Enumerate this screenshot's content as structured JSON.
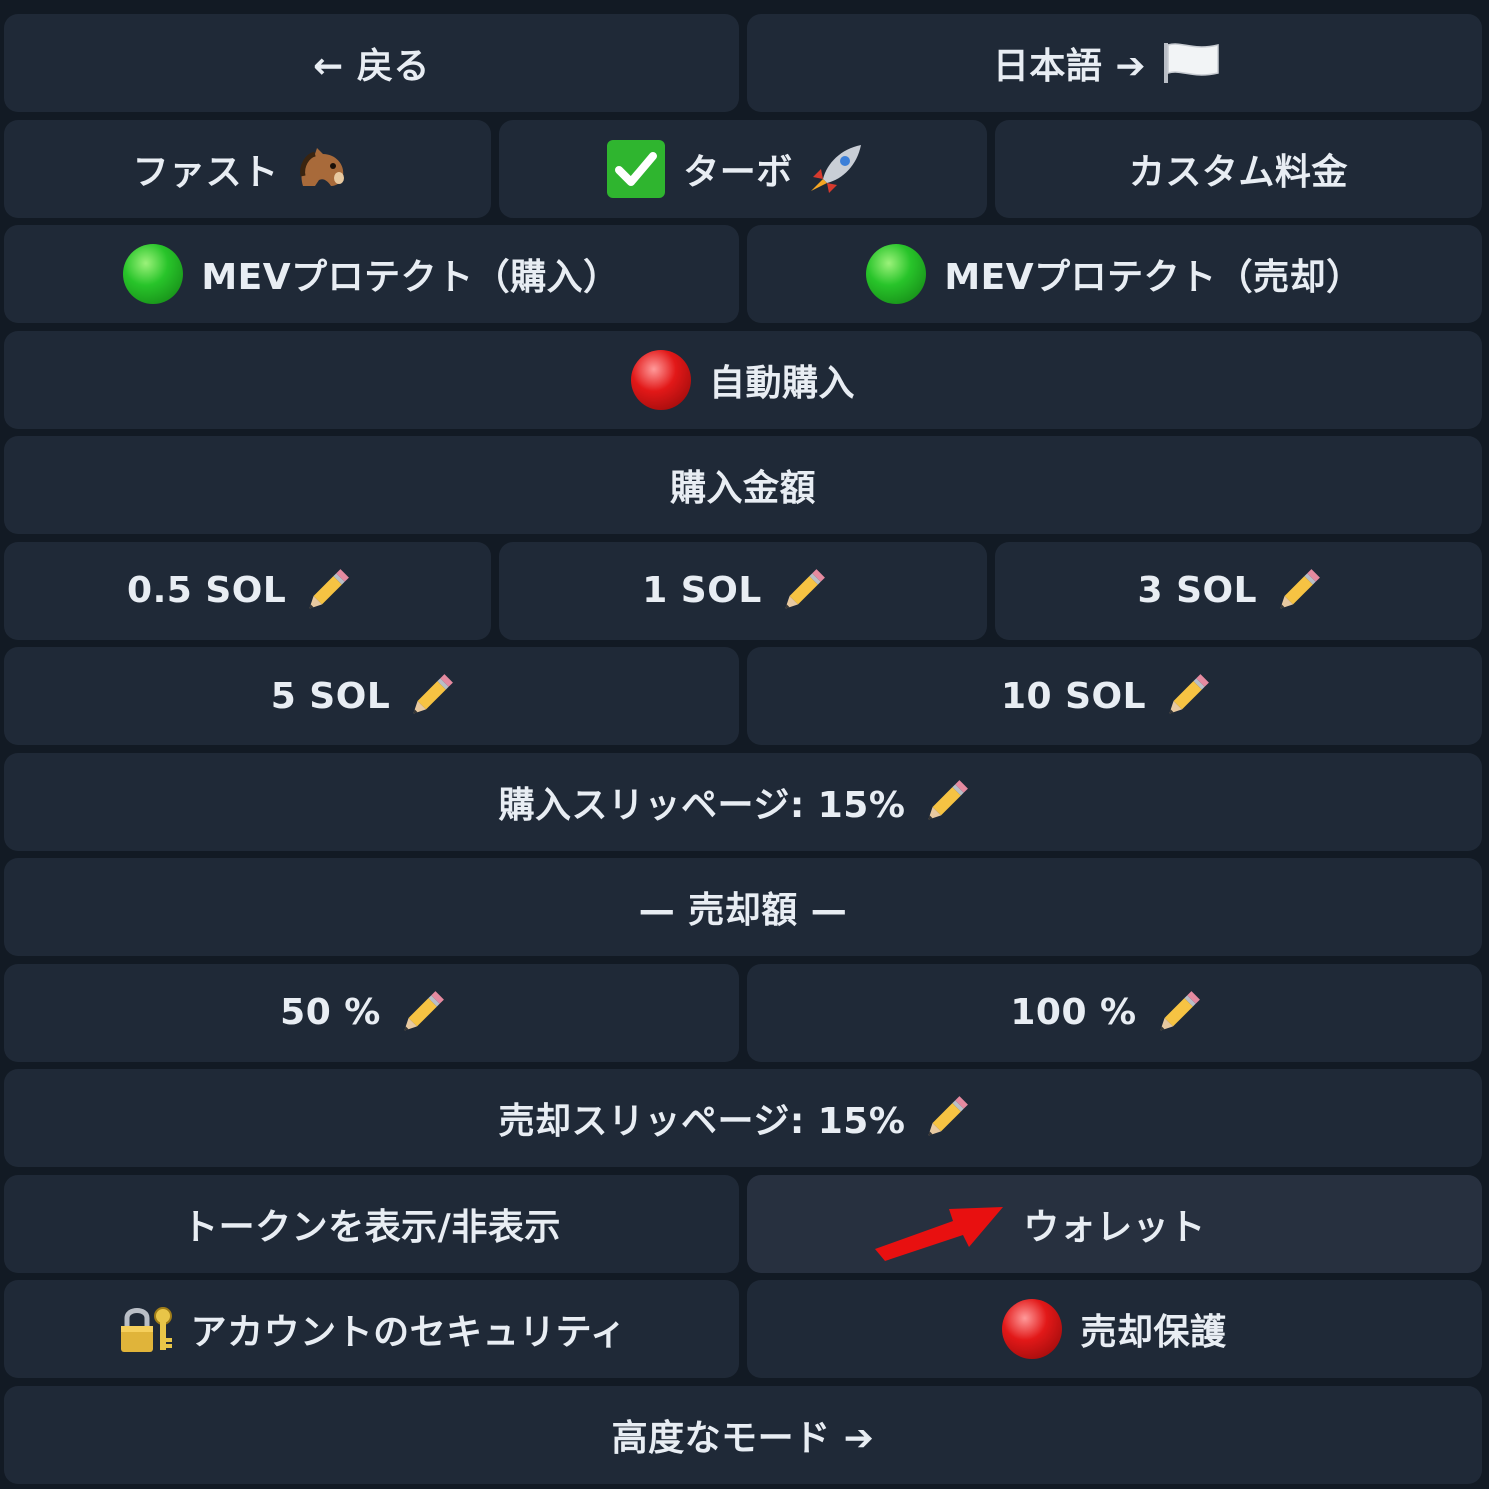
{
  "rows": {
    "r1": {
      "back": "← 戻る",
      "language": "日本語 ➔"
    },
    "r2": {
      "fast": "ファスト",
      "turbo": "ターボ",
      "custom_fee": "カスタム料金"
    },
    "r3": {
      "mev_buy": "MEVプロテクト（購入）",
      "mev_sell": "MEVプロテクト（売却）"
    },
    "r4": {
      "auto_buy": "自動購入"
    },
    "r5": {
      "buy_amount": "購入金額"
    },
    "r6": {
      "amt1": "0.5 SOL",
      "amt2": "1 SOL",
      "amt3": "3 SOL"
    },
    "r7": {
      "amt4": "5 SOL",
      "amt5": "10 SOL"
    },
    "r8": {
      "buy_slippage": "購入スリッページ: 15%"
    },
    "r9": {
      "sell_amount": "— 売却額 —"
    },
    "r10": {
      "pct1": "50 %",
      "pct2": "100 %"
    },
    "r11": {
      "sell_slippage": "売却スリッページ: 15%"
    },
    "r12": {
      "toggle_tokens": "トークンを表示/非表示",
      "wallet": "ウォレット"
    },
    "r13": {
      "account_security": "アカウントのセキュリティ",
      "sell_protection": "売却保護"
    },
    "r14": {
      "advanced_mode": "高度なモード ➔"
    }
  },
  "icons": {
    "flag": "white-flag-icon",
    "horse": "horse-face-icon",
    "check": "check-mark-button-icon",
    "rocket": "rocket-icon",
    "pencil": "pencil-icon",
    "status_on": "green-circle-icon",
    "status_off": "red-circle-icon",
    "lock": "locked-with-key-icon",
    "pointer": "red-arrow-annotation"
  },
  "colors": {
    "background": "#121a24",
    "button": "#1f2937",
    "button_highlight": "#27303f",
    "text": "#e8edf3",
    "status_on": "#28c42a",
    "status_off": "#e21818",
    "annotation_arrow": "#e81010"
  }
}
